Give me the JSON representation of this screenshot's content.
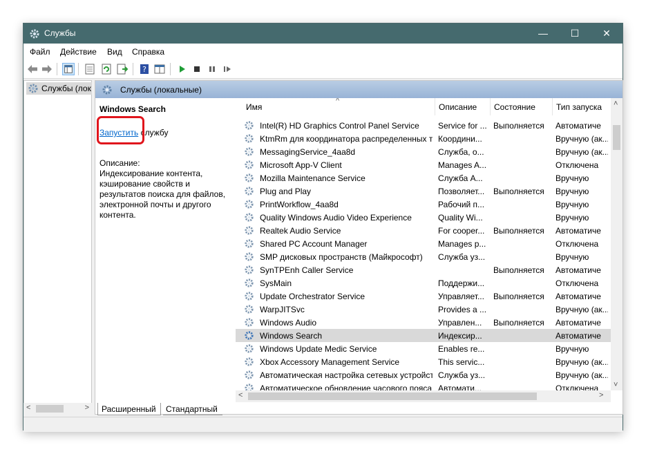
{
  "window": {
    "title": "Службы",
    "controls": {
      "minimize": "—",
      "maximize": "☐",
      "close": "✕"
    }
  },
  "menu": [
    "Файл",
    "Действие",
    "Вид",
    "Справка"
  ],
  "left_pane": {
    "tree_item": "Службы (лок"
  },
  "right_header": {
    "title": "Службы (локальные)"
  },
  "detail": {
    "service_name": "Windows Search",
    "start_link": "Запустить",
    "start_suffix": " службу",
    "description_label": "Описание:",
    "description_text": "Индексирование контента, кэширование свойств и результатов поиска для файлов, электронной почты и другого контента."
  },
  "columns": {
    "name": "Имя",
    "description": "Описание",
    "status": "Состояние",
    "startup": "Тип запуска"
  },
  "sort_indicator": "^",
  "services": [
    {
      "name": "Intel(R) HD Graphics Control Panel Service",
      "description": "Service for ...",
      "status": "Выполняется",
      "startup": "Автоматиче"
    },
    {
      "name": "KtmRm для координатора распределенных т...",
      "description": "Координи...",
      "status": "",
      "startup": "Вручную (ак..."
    },
    {
      "name": "MessagingService_4aa8d",
      "description": "Служба, о...",
      "status": "",
      "startup": "Вручную (ак..."
    },
    {
      "name": "Microsoft App-V Client",
      "description": "Manages A...",
      "status": "",
      "startup": "Отключена"
    },
    {
      "name": "Mozilla Maintenance Service",
      "description": "Служба А...",
      "status": "",
      "startup": "Вручную"
    },
    {
      "name": "Plug and Play",
      "description": "Позволяет...",
      "status": "Выполняется",
      "startup": "Вручную"
    },
    {
      "name": "PrintWorkflow_4aa8d",
      "description": "Рабочий п...",
      "status": "",
      "startup": "Вручную"
    },
    {
      "name": "Quality Windows Audio Video Experience",
      "description": "Quality Wi...",
      "status": "",
      "startup": "Вручную"
    },
    {
      "name": "Realtek Audio Service",
      "description": "For cooper...",
      "status": "Выполняется",
      "startup": "Автоматиче"
    },
    {
      "name": "Shared PC Account Manager",
      "description": "Manages p...",
      "status": "",
      "startup": "Отключена"
    },
    {
      "name": "SMP дисковых пространств (Майкрософт)",
      "description": "Служба уз...",
      "status": "",
      "startup": "Вручную"
    },
    {
      "name": "SynTPEnh Caller Service",
      "description": "",
      "status": "Выполняется",
      "startup": "Автоматиче"
    },
    {
      "name": "SysMain",
      "description": "Поддержи...",
      "status": "",
      "startup": "Отключена"
    },
    {
      "name": "Update Orchestrator Service",
      "description": "Управляет...",
      "status": "Выполняется",
      "startup": "Автоматиче"
    },
    {
      "name": "WarpJITSvc",
      "description": "Provides a ...",
      "status": "",
      "startup": "Вручную (ак..."
    },
    {
      "name": "Windows Audio",
      "description": "Управлен...",
      "status": "Выполняется",
      "startup": "Автоматиче"
    },
    {
      "name": "Windows Search",
      "description": "Индексир...",
      "status": "",
      "startup": "Автоматиче",
      "selected": true
    },
    {
      "name": "Windows Update Medic Service",
      "description": "Enables re...",
      "status": "",
      "startup": "Вручную"
    },
    {
      "name": "Xbox Accessory Management Service",
      "description": "This servic...",
      "status": "",
      "startup": "Вручную (ак..."
    },
    {
      "name": "Автоматическая настройка сетевых устройств",
      "description": "Служба уз...",
      "status": "",
      "startup": "Вручную (ак..."
    },
    {
      "name": "Автоматическое обновление часового пояса",
      "description": "Автомати...",
      "status": "",
      "startup": "Отключена"
    }
  ],
  "tabs": [
    "Расширенный",
    "Стандартный"
  ],
  "colors": {
    "titlebar": "#456a6e",
    "highlight_box": "#e0151c",
    "link": "#0066cc",
    "selected_row": "#d9d9d9"
  },
  "icons": [
    "gear-icon",
    "back-arrow-icon",
    "forward-arrow-icon",
    "console-tree-icon",
    "properties-icon",
    "refresh-icon",
    "export-icon",
    "help-icon",
    "view-icon",
    "play-icon",
    "stop-icon",
    "pause-icon",
    "restart-icon"
  ]
}
